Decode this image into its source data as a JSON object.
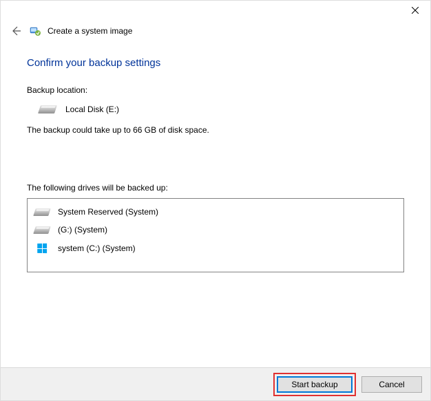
{
  "window": {
    "title": "Create a system image"
  },
  "heading": "Confirm your backup settings",
  "backup_location_label": "Backup location:",
  "backup_location_value": "Local Disk (E:)",
  "size_info": "The backup could take up to 66 GB of disk space.",
  "drives_label": "The following drives will be backed up:",
  "drives": [
    {
      "name": "System Reserved (System)",
      "icon": "disk"
    },
    {
      "name": "(G:) (System)",
      "icon": "disk"
    },
    {
      "name": "system (C:) (System)",
      "icon": "windows-disk"
    }
  ],
  "buttons": {
    "start": "Start backup",
    "cancel": "Cancel"
  }
}
